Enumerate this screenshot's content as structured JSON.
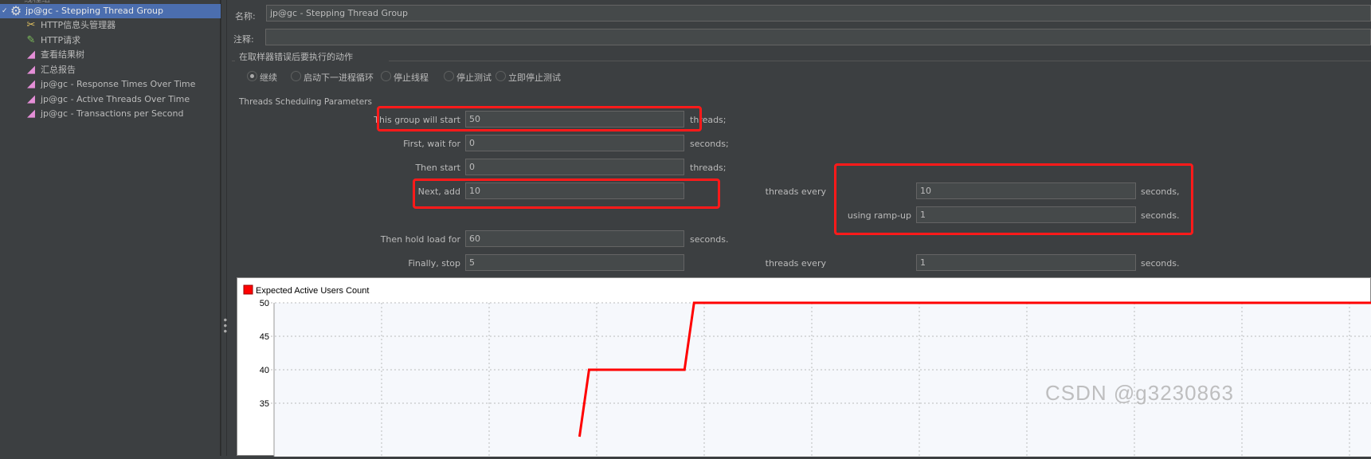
{
  "tree": {
    "top_partial": "线程组",
    "selected": "jp@gc - Stepping Thread Group",
    "items": [
      {
        "label": "HTTP信息头管理器",
        "icon": "wrench-screwdriver-icon"
      },
      {
        "label": "HTTP请求",
        "icon": "pipette-icon"
      },
      {
        "label": "查看结果树",
        "icon": "graph-icon"
      },
      {
        "label": "汇总报告",
        "icon": "graph-icon"
      },
      {
        "label": "jp@gc - Response Times Over Time",
        "icon": "graph-icon"
      },
      {
        "label": "jp@gc - Active Threads Over Time",
        "icon": "graph-icon"
      },
      {
        "label": "jp@gc - Transactions per Second",
        "icon": "graph-icon"
      }
    ]
  },
  "form": {
    "name_label": "名称:",
    "name_value": "jp@gc - Stepping Thread Group",
    "comment_label": "注释:",
    "comment_value": "",
    "error_action_title": "在取样器错误后要执行的动作",
    "error_actions": [
      {
        "label": "继续",
        "selected": true
      },
      {
        "label": "启动下一进程循环",
        "selected": false
      },
      {
        "label": "停止线程",
        "selected": false
      },
      {
        "label": "停止测试",
        "selected": false
      },
      {
        "label": "立即停止测试",
        "selected": false
      }
    ],
    "scheduling_title": "Threads Scheduling Parameters",
    "rows": [
      {
        "label": "This group will start",
        "value": "50",
        "suffix": "threads;"
      },
      {
        "label": "First, wait for",
        "value": "0",
        "suffix": "seconds;"
      },
      {
        "label": "Then start",
        "value": "0",
        "suffix": "threads;"
      },
      {
        "label": "Next, add",
        "value": "10",
        "suffix": ""
      },
      {
        "label": "Then hold load for",
        "value": "60",
        "suffix": "seconds."
      },
      {
        "label": "Finally, stop",
        "value": "5",
        "suffix": ""
      }
    ],
    "next_add_right": {
      "label": "threads every",
      "value": "10",
      "suffix": "seconds,"
    },
    "ramp_up": {
      "label": "using ramp-up",
      "value": "1",
      "suffix": "seconds."
    },
    "finally_right": {
      "label": "threads every",
      "value": "1",
      "suffix": "seconds."
    }
  },
  "chart_data": {
    "type": "line",
    "legend": "Expected Active Users Count",
    "legend_placement": "top-left",
    "series": [
      {
        "name": "Expected Active Users Count",
        "color": "#ff0000",
        "points": [
          [
            32,
            30
          ],
          [
            33,
            40
          ],
          [
            43,
            40
          ],
          [
            44,
            50
          ],
          [
            115,
            50
          ]
        ]
      }
    ],
    "yticks": [
      35,
      40,
      45,
      50
    ],
    "ylim": [
      33,
      50
    ],
    "xlim": [
      0,
      115
    ],
    "grid": true
  },
  "watermark": "CSDN @g3230863",
  "colors": {
    "accent": "#4b6eaf",
    "highlight": "#ff1a1a",
    "series": "#ff0000"
  }
}
